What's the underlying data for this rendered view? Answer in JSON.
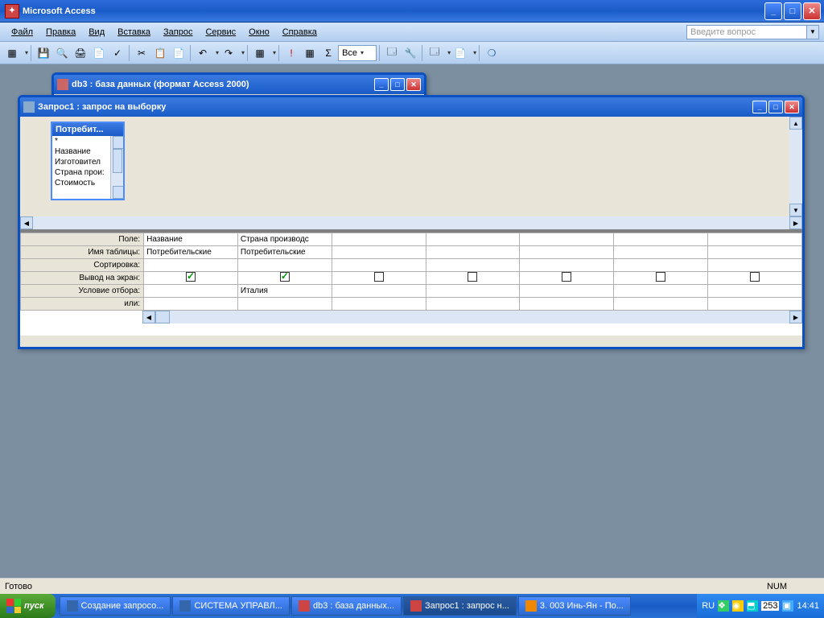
{
  "app": {
    "title": "Microsoft Access"
  },
  "menu": [
    "Файл",
    "Правка",
    "Вид",
    "Вставка",
    "Запрос",
    "Сервис",
    "Окно",
    "Справка"
  ],
  "ask_placeholder": "Введите вопрос",
  "toolbar": {
    "combo_value": "Все"
  },
  "db_window": {
    "title": "db3 : база данных (формат Access 2000)"
  },
  "query_window": {
    "title": "Запрос1 : запрос на выборку",
    "field_list": {
      "title": "Потребит...",
      "items": [
        "*",
        "Название",
        "Изготовител",
        "Страна прои:",
        "Стоимость"
      ]
    },
    "grid": {
      "row_labels": [
        "Поле:",
        "Имя таблицы:",
        "Сортировка:",
        "Вывод на экран:",
        "Условие отбора:",
        "или:"
      ],
      "columns": [
        {
          "field": "Название",
          "table": "Потребительские",
          "sort": "",
          "show": true,
          "criteria": "",
          "or": ""
        },
        {
          "field": "Страна производс",
          "table": "Потребительские",
          "sort": "",
          "show": true,
          "criteria": "Италия",
          "or": ""
        },
        {
          "field": "",
          "table": "",
          "sort": "",
          "show": false,
          "criteria": "",
          "or": ""
        },
        {
          "field": "",
          "table": "",
          "sort": "",
          "show": false,
          "criteria": "",
          "or": ""
        },
        {
          "field": "",
          "table": "",
          "sort": "",
          "show": false,
          "criteria": "",
          "or": ""
        },
        {
          "field": "",
          "table": "",
          "sort": "",
          "show": false,
          "criteria": "",
          "or": ""
        },
        {
          "field": "",
          "table": "",
          "sort": "",
          "show": false,
          "criteria": "",
          "or": ""
        }
      ]
    }
  },
  "status": {
    "text": "Готово",
    "indicator": "NUM"
  },
  "taskbar": {
    "start": "пуск",
    "lang": "RU",
    "time": "14:41",
    "count": "253",
    "buttons": [
      {
        "label": "Создание запросо...",
        "ico": "#36a"
      },
      {
        "label": "СИСТЕМА УПРАВЛ...",
        "ico": "#36a"
      },
      {
        "label": "db3 : база данных...",
        "ico": "#c44"
      },
      {
        "label": "Запрос1 : запрос н...",
        "ico": "#c44",
        "active": true
      },
      {
        "label": "3. 003 Инь-Ян - По...",
        "ico": "#e80"
      }
    ]
  }
}
